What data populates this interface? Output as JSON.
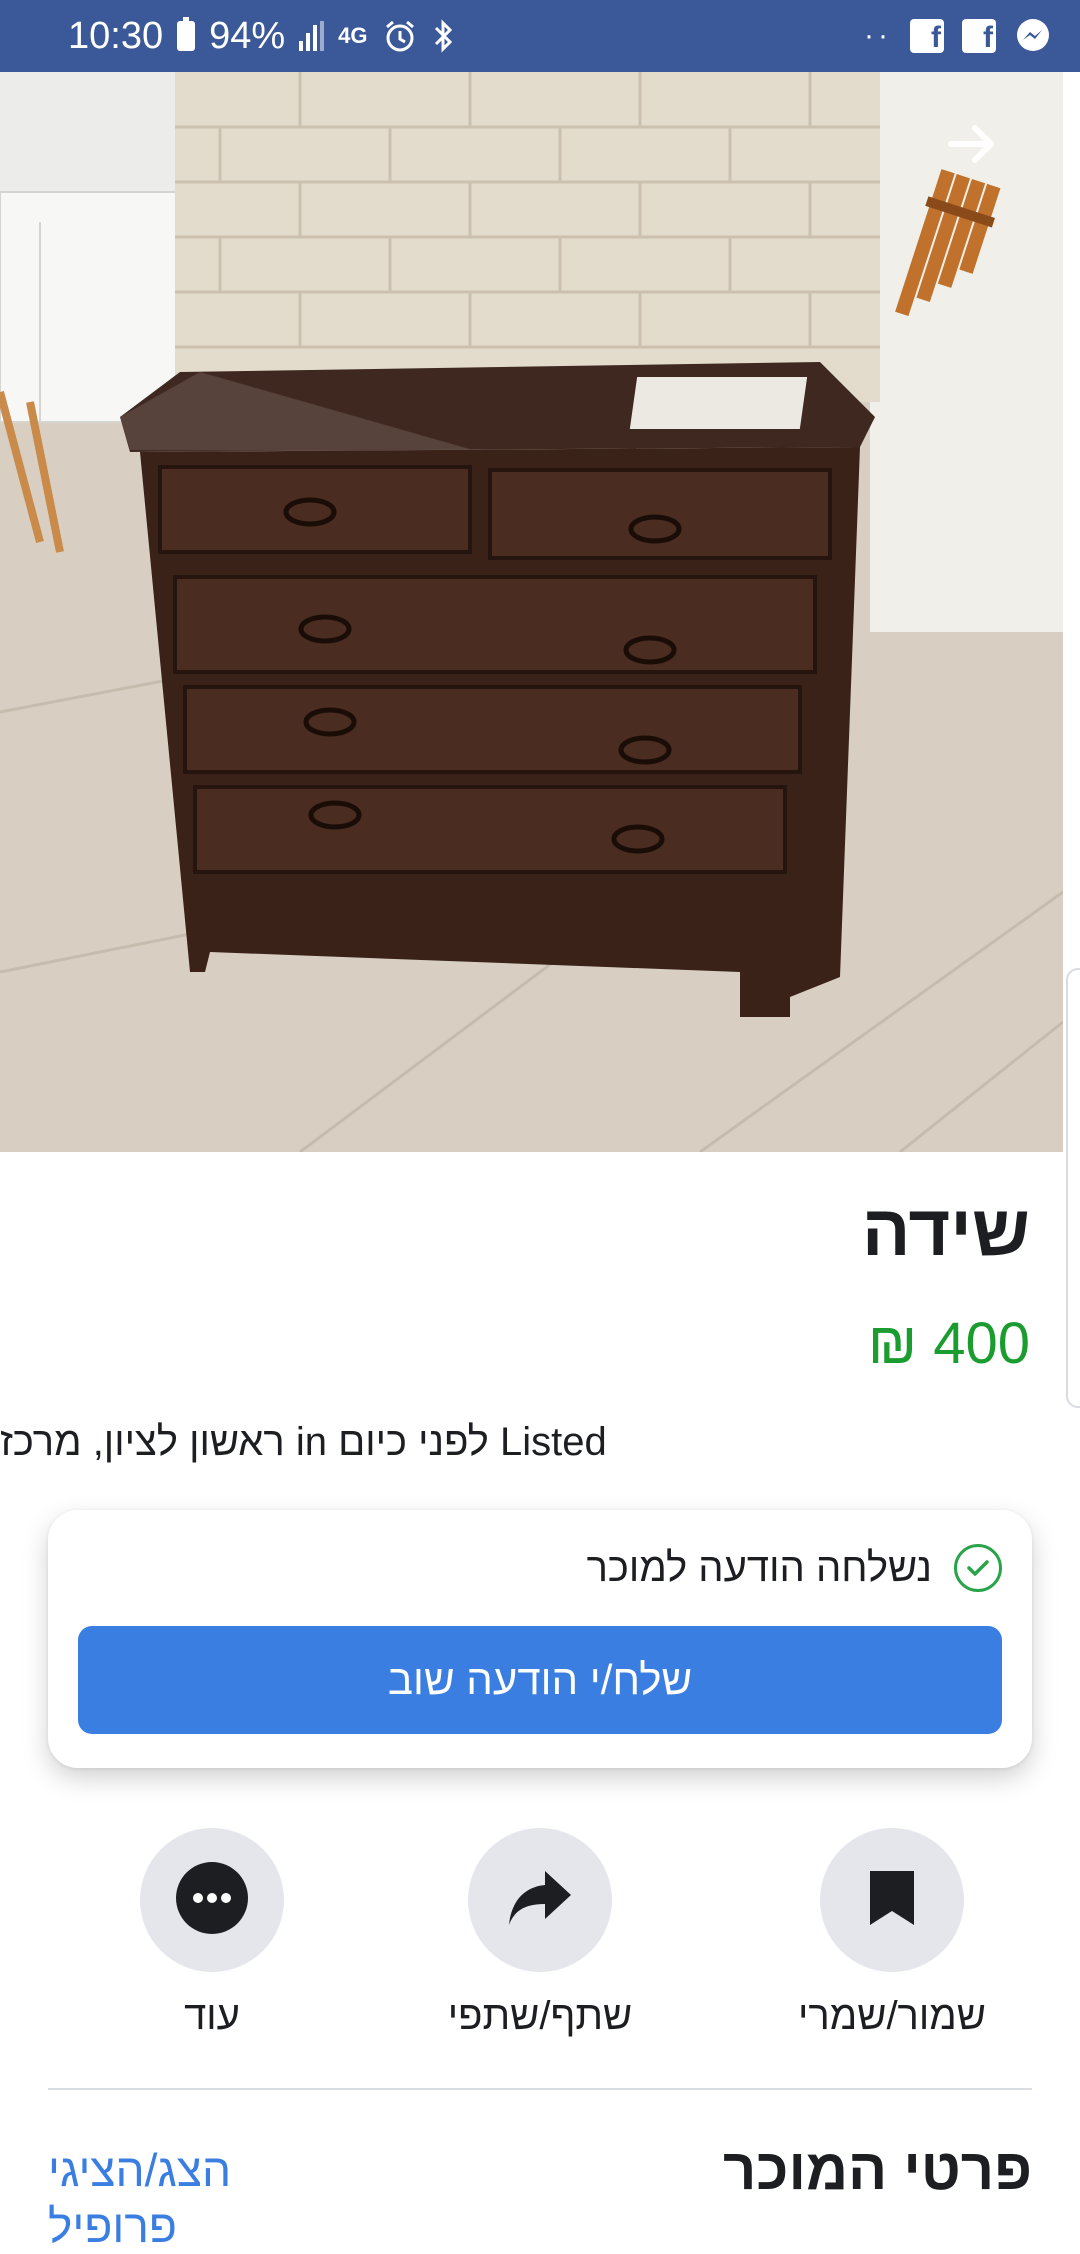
{
  "status_bar": {
    "time": "10:30",
    "battery": "94%",
    "network": "4G",
    "icons": [
      "battery-icon",
      "signal-icon",
      "alarm-icon",
      "bluetooth-icon",
      "facebook-icon",
      "facebook-icon",
      "messenger-icon"
    ],
    "background_color": "#3b5998"
  },
  "listing": {
    "title": "שידה",
    "price": "400 ₪",
    "price_color": "#1a9c2f",
    "location_line": "ראשון לציון, מרכז in לפני כיום Listed"
  },
  "message_card": {
    "status_text": "נשלחה הודעה למוכר",
    "send_again_label": "שלח/י הודעה שוב",
    "button_color": "#3b7ee2"
  },
  "actions": [
    {
      "label": "שמור/שמרי",
      "icon": "bookmark-icon"
    },
    {
      "label": "שתף/שתפי",
      "icon": "share-icon"
    },
    {
      "label": "עוד",
      "icon": "more-icon"
    }
  ],
  "seller": {
    "heading": "פרטי המוכר",
    "profile_link": "הצג/הציגי פרופיל"
  }
}
